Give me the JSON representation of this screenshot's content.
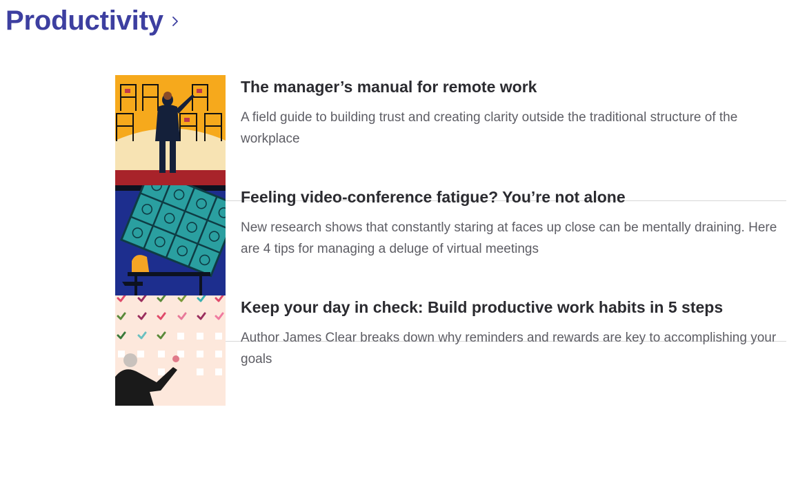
{
  "section": {
    "title": "Productivity",
    "chevron_icon": "chevron-right-icon"
  },
  "articles": [
    {
      "title": "The manager’s manual for remote work",
      "description": "A field guide to building trust and creating clarity outside the traditional structure of the workplace",
      "image": "conductor-and-empty-chairs-illustration"
    },
    {
      "title": "Feeling video-conference fatigue? You’re not alone",
      "description": "New research shows that constantly staring at faces up close can be mentally draining. Here are 4 tips for managing a deluge of virtual meetings",
      "image": "person-overwhelmed-by-video-call-grid-illustration"
    },
    {
      "title": "Keep your day in check: Build productive work habits in 5 steps",
      "description": "Author James Clear breaks down why reminders and rewards are key to accomplishing your goals",
      "image": "man-drawing-checkmarks-illustration"
    }
  ],
  "colors": {
    "title_accent": "#3d3fa0",
    "heading": "#2b2b30",
    "body_text": "#5d5d64",
    "divider": "#d6d6d6"
  }
}
